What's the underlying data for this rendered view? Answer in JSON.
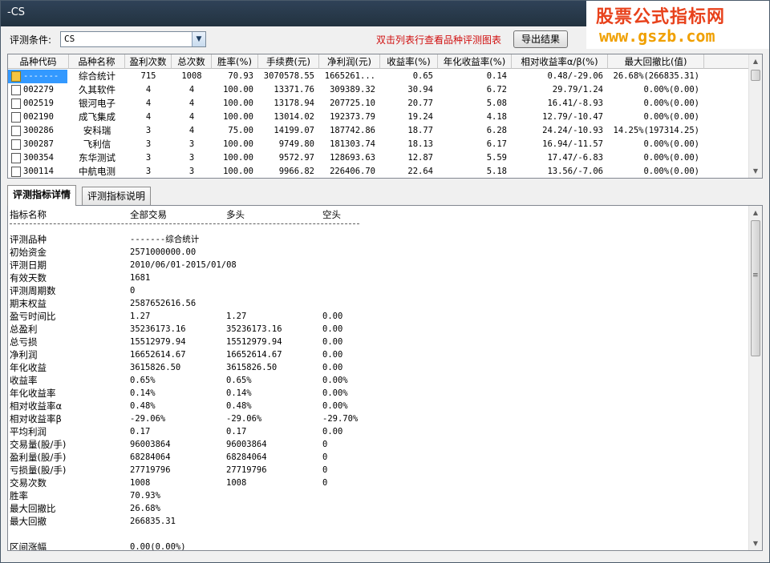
{
  "window": {
    "title": "-CS"
  },
  "watermark": {
    "line1": "股票公式指标网",
    "line2": "www.gszb.com"
  },
  "toolbar": {
    "condition_label": "评测条件:",
    "condition_value": "CS",
    "hint": "双击列表行查看品种评测图表",
    "export_label": "导出结果"
  },
  "grid": {
    "columns": [
      "品种代码",
      "品种名称",
      "盈利次数",
      "总次数",
      "胜率(%)",
      "手续费(元)",
      "净利润(元)",
      "收益率(%)",
      "年化收益率(%)",
      "相对收益率α/β(%)",
      "最大回撤比(值)"
    ],
    "rows": [
      {
        "code": "-------",
        "name": "综合统计",
        "wins": "715",
        "total": "1008",
        "win_rate": "70.93",
        "fee": "3070578.55",
        "net": "1665261...",
        "ret": "0.65",
        "annual": "0.14",
        "rel": "0.48/-29.06",
        "dd": "26.68%(266835.31)",
        "special": true
      },
      {
        "code": "002279",
        "name": "久其软件",
        "wins": "4",
        "total": "4",
        "win_rate": "100.00",
        "fee": "13371.76",
        "net": "309389.32",
        "ret": "30.94",
        "annual": "6.72",
        "rel": "29.79/1.24",
        "dd": "0.00%(0.00)"
      },
      {
        "code": "002519",
        "name": "银河电子",
        "wins": "4",
        "total": "4",
        "win_rate": "100.00",
        "fee": "13178.94",
        "net": "207725.10",
        "ret": "20.77",
        "annual": "5.08",
        "rel": "16.41/-8.93",
        "dd": "0.00%(0.00)"
      },
      {
        "code": "002190",
        "name": "成飞集成",
        "wins": "4",
        "total": "4",
        "win_rate": "100.00",
        "fee": "13014.02",
        "net": "192373.79",
        "ret": "19.24",
        "annual": "4.18",
        "rel": "12.79/-10.47",
        "dd": "0.00%(0.00)"
      },
      {
        "code": "300286",
        "name": "安科瑞",
        "wins": "3",
        "total": "4",
        "win_rate": "75.00",
        "fee": "14199.07",
        "net": "187742.86",
        "ret": "18.77",
        "annual": "6.28",
        "rel": "24.24/-10.93",
        "dd": "14.25%(197314.25)"
      },
      {
        "code": "300287",
        "name": "飞利信",
        "wins": "3",
        "total": "3",
        "win_rate": "100.00",
        "fee": "9749.80",
        "net": "181303.74",
        "ret": "18.13",
        "annual": "6.17",
        "rel": "16.94/-11.57",
        "dd": "0.00%(0.00)"
      },
      {
        "code": "300354",
        "name": "东华测试",
        "wins": "3",
        "total": "3",
        "win_rate": "100.00",
        "fee": "9572.97",
        "net": "128693.63",
        "ret": "12.87",
        "annual": "5.59",
        "rel": "17.47/-6.83",
        "dd": "0.00%(0.00)"
      },
      {
        "code": "300114",
        "name": "中航电测",
        "wins": "3",
        "total": "3",
        "win_rate": "100.00",
        "fee": "9966.82",
        "net": "226406.70",
        "ret": "22.64",
        "annual": "5.18",
        "rel": "13.56/-7.06",
        "dd": "0.00%(0.00)"
      }
    ]
  },
  "tabs": [
    {
      "label": "评测指标详情",
      "active": true
    },
    {
      "label": "评测指标说明",
      "active": false
    }
  ],
  "detail": {
    "headers": [
      "指标名称",
      "全部交易",
      "多头",
      "空头"
    ],
    "rows": [
      [
        "评测品种",
        "-------综合统计",
        "",
        ""
      ],
      [
        "初始资金",
        "2571000000.00",
        "",
        ""
      ],
      [
        "评测日期",
        "2010/06/01-2015/01/08",
        "",
        ""
      ],
      [
        "有效天数",
        "1681",
        "",
        ""
      ],
      [
        "评测周期数",
        "0",
        "",
        ""
      ],
      [
        "期末权益",
        "2587652616.56",
        "",
        ""
      ],
      [
        "盈亏时间比",
        "1.27",
        "1.27",
        "0.00"
      ],
      [
        "总盈利",
        "35236173.16",
        "35236173.16",
        "0.00"
      ],
      [
        "总亏损",
        "15512979.94",
        "15512979.94",
        "0.00"
      ],
      [
        "净利润",
        "16652614.67",
        "16652614.67",
        "0.00"
      ],
      [
        "年化收益",
        "3615826.50",
        "3615826.50",
        "0.00"
      ],
      [
        "收益率",
        "0.65%",
        "0.65%",
        "0.00%"
      ],
      [
        "年化收益率",
        "0.14%",
        "0.14%",
        "0.00%"
      ],
      [
        "相对收益率α",
        "0.48%",
        "0.48%",
        "0.00%"
      ],
      [
        "相对收益率β",
        "-29.06%",
        "-29.06%",
        "-29.70%"
      ],
      [
        "平均利润",
        "0.17",
        "0.17",
        "0.00"
      ],
      [
        "交易量(股/手)",
        "96003864",
        "96003864",
        "0"
      ],
      [
        "盈利量(股/手)",
        "68284064",
        "68284064",
        "0"
      ],
      [
        "亏损量(股/手)",
        "27719796",
        "27719796",
        "0"
      ],
      [
        "交易次数",
        "1008",
        "1008",
        "0"
      ],
      [
        "胜率",
        "70.93%",
        "",
        ""
      ],
      [
        "最大回撤比",
        "26.68%",
        "",
        ""
      ],
      [
        "最大回撤",
        "266835.31",
        "",
        ""
      ],
      [
        "",
        "",
        "",
        ""
      ],
      [
        "区间涨幅",
        "0.00(0.00%)",
        "",
        ""
      ]
    ]
  }
}
